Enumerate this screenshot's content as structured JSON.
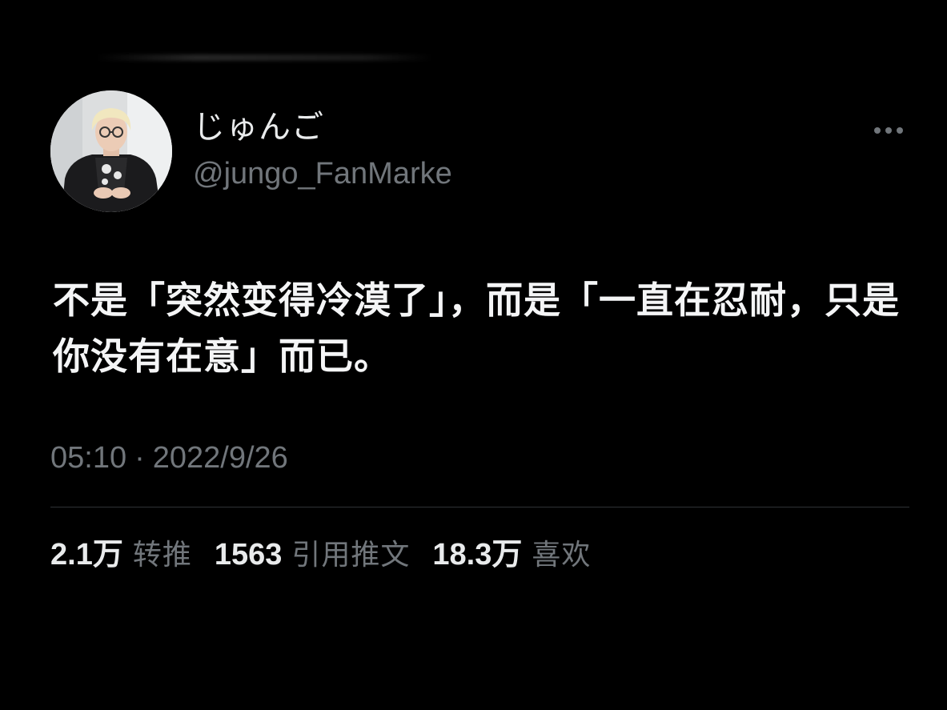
{
  "tweet": {
    "author": {
      "display_name": "じゅんご",
      "handle": "@jungo_FanMarke"
    },
    "text": "不是「突然变得冷漠了」，而是「一直在忍耐，只是你没有在意」而已。",
    "timestamp": {
      "time": "05:10",
      "separator": "·",
      "date": "2022/9/26"
    },
    "stats": {
      "retweets": {
        "value": "2.1万",
        "label": "转推"
      },
      "quotes": {
        "value": "1563",
        "label": "引用推文"
      },
      "likes": {
        "value": "18.3万",
        "label": "喜欢"
      }
    },
    "icons": {
      "more": "more-options-icon",
      "avatar": "profile-avatar"
    }
  },
  "colors": {
    "background": "#000000",
    "primary_text": "#e7e9ea",
    "secondary_text": "#71767b",
    "divider": "#2f3336"
  }
}
